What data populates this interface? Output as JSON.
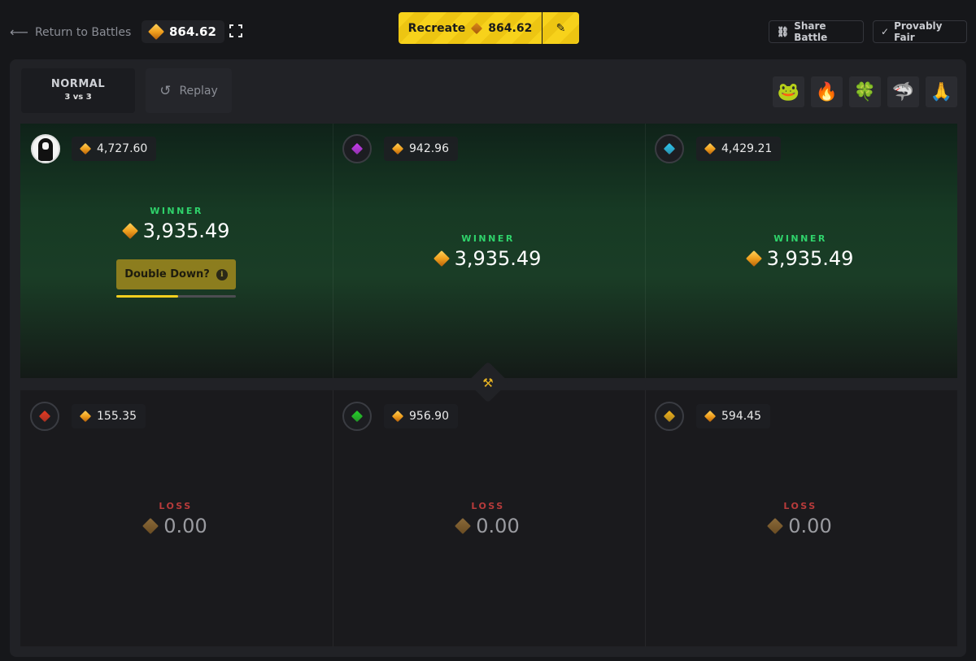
{
  "header": {
    "back_label": "Return to Battles",
    "balance": "864.62",
    "recreate_label": "Recreate",
    "recreate_price": "864.62",
    "share_label": "Share Battle",
    "fair_label": "Provably Fair"
  },
  "battle": {
    "mode": "NORMAL",
    "format": "3 vs 3",
    "replay_label": "Replay",
    "emotes": [
      "🐸",
      "🔥",
      "🍀",
      "🦈",
      "🙏"
    ]
  },
  "top_team": {
    "players": [
      {
        "avatar_color": "#ffffff",
        "amount": "4,727.60",
        "status": "WINNER",
        "total": "3,935.49"
      },
      {
        "avatar_color": "#c93cf0",
        "amount": "942.96",
        "status": "WINNER",
        "total": "3,935.49"
      },
      {
        "avatar_color": "#2fc7f0",
        "amount": "4,429.21",
        "status": "WINNER",
        "total": "3,935.49"
      }
    ],
    "double_down_label": "Double Down?",
    "double_down_progress": 0.52
  },
  "bottom_team": {
    "players": [
      {
        "avatar_color": "#e83a22",
        "amount": "155.35",
        "status": "LOSS",
        "total": "0.00"
      },
      {
        "avatar_color": "#26d12a",
        "amount": "956.90",
        "status": "LOSS",
        "total": "0.00"
      },
      {
        "avatar_color": "#f2b41c",
        "amount": "594.45",
        "status": "LOSS",
        "total": "0.00"
      }
    ]
  },
  "colors": {
    "accent": "#f7d21b",
    "win": "#2fd36b",
    "loss": "#b83b3b"
  }
}
